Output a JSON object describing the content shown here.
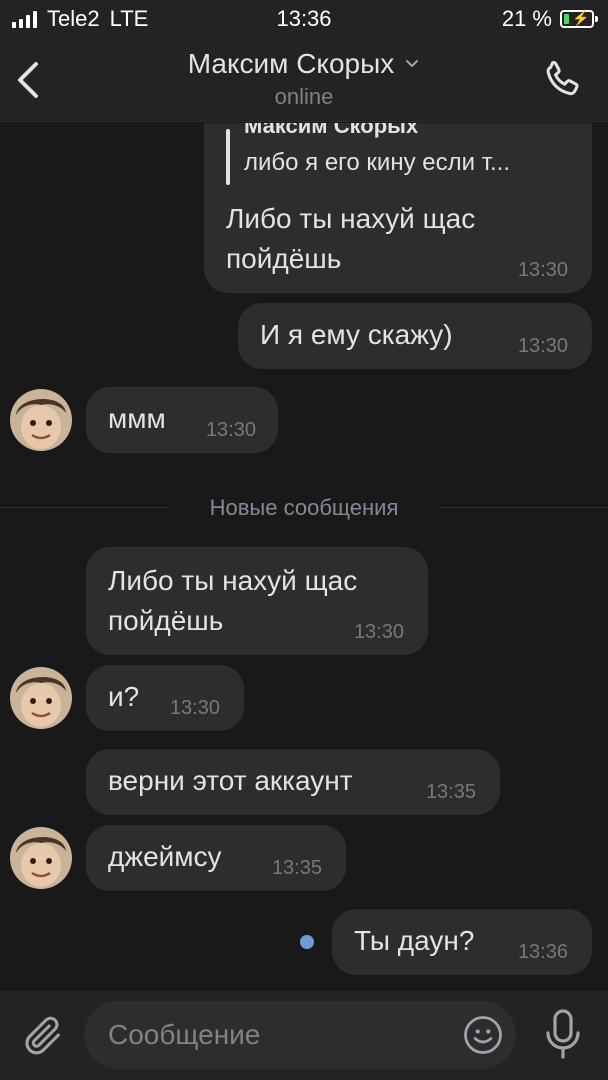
{
  "status_bar": {
    "carrier": "Tele2",
    "network": "LTE",
    "time": "13:36",
    "battery_percent": "21 %",
    "battery_level": 0.21,
    "battery_color": "#4cd964"
  },
  "header": {
    "back_icon": "chevron-left-icon",
    "title": "Максим Скорых",
    "title_chevron_icon": "chevron-down-icon",
    "subtitle": "online",
    "call_icon": "phone-icon"
  },
  "messages": [
    {
      "direction": "outgoing",
      "reply": {
        "author": "Максим Скорых",
        "text": "либо я его кину если т..."
      },
      "text_lines": [
        "Либо ты нахуй щас",
        "пойдёшь"
      ],
      "time": "13:30"
    },
    {
      "direction": "outgoing",
      "text": "И я ему скажу)",
      "time": "13:30"
    },
    {
      "direction": "incoming",
      "text": "ммм",
      "time": "13:30",
      "avatar": true
    }
  ],
  "new_messages_divider": "Новые сообщения",
  "new_messages": [
    {
      "direction": "incoming",
      "text_lines": [
        "Либо ты нахуй щас",
        "пойдёшь"
      ],
      "time": "13:30",
      "avatar": false
    },
    {
      "direction": "incoming",
      "text": "и?",
      "time": "13:30",
      "avatar": true
    },
    {
      "direction": "incoming",
      "text": "верни этот аккаунт",
      "time": "13:35",
      "avatar": false
    },
    {
      "direction": "incoming",
      "text": "джеймсу",
      "time": "13:35",
      "avatar": true
    },
    {
      "direction": "outgoing",
      "text": "Ты даун?",
      "time": "13:36",
      "unread": true
    }
  ],
  "composer": {
    "attach_icon": "paperclip-icon",
    "placeholder": "Сообщение",
    "value": "",
    "emoji_icon": "smile-icon",
    "mic_icon": "microphone-icon"
  },
  "colors": {
    "background": "#19191a",
    "bar": "#232324",
    "bubble": "#2c2d2e",
    "text": "#e1e3e6",
    "muted": "#828282",
    "unread_dot": "#6f9ad8"
  }
}
